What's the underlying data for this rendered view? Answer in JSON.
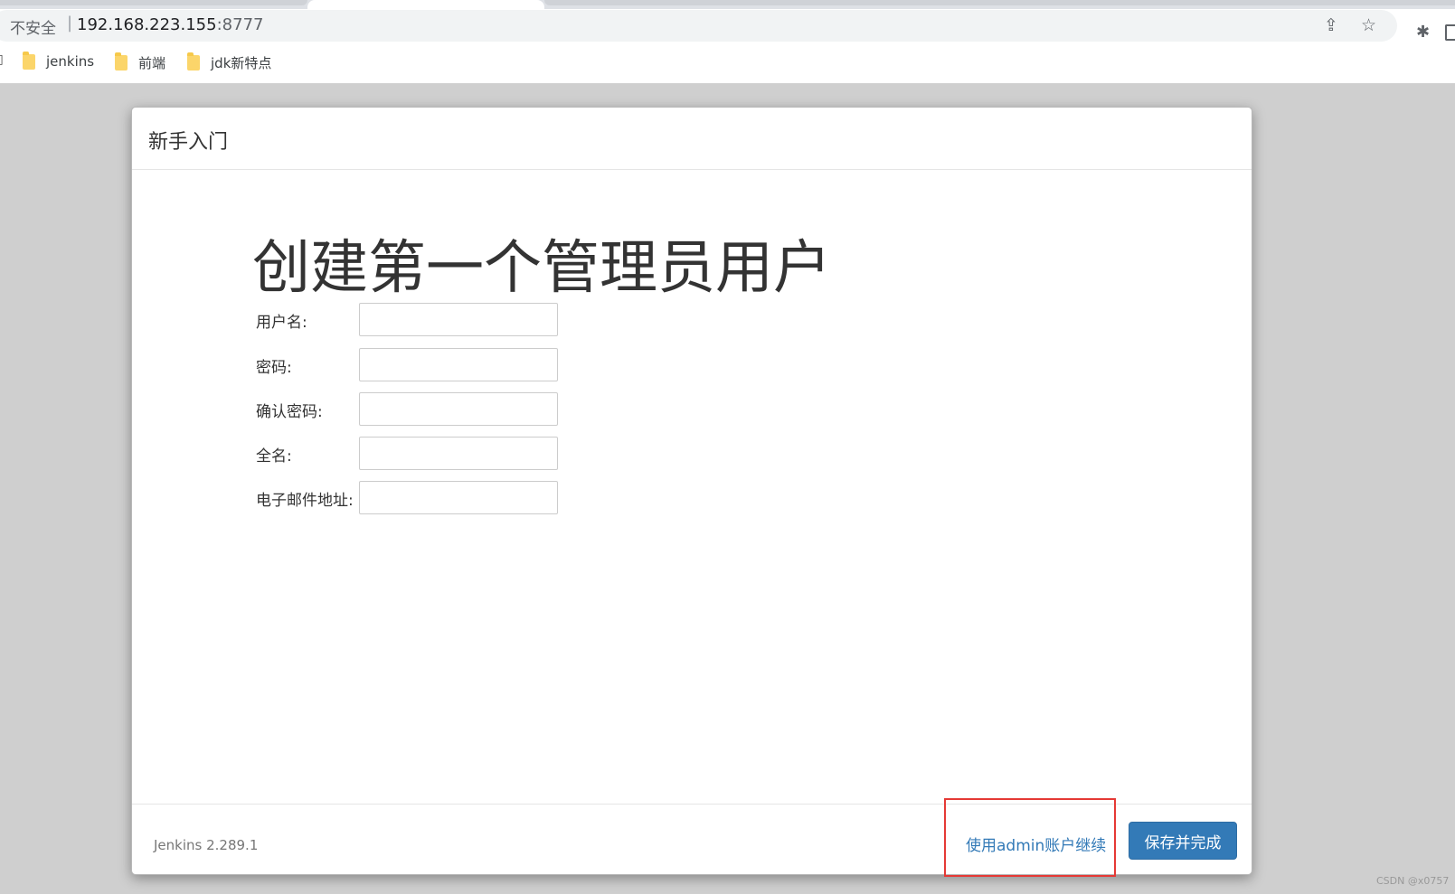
{
  "browser": {
    "security_label": "不安全",
    "separator": "|",
    "url_host": "192.168.223.155",
    "url_port": ":8777",
    "bookmarks": [
      {
        "label": "jenkins"
      },
      {
        "label": "前端"
      },
      {
        "label": "jdk新特点"
      }
    ]
  },
  "modal": {
    "title": "新手入门",
    "heading": "创建第一个管理员用户",
    "fields": [
      {
        "label": "用户名:",
        "value": ""
      },
      {
        "label": "密码:",
        "value": ""
      },
      {
        "label": "确认密码:",
        "value": ""
      },
      {
        "label": "全名:",
        "value": ""
      },
      {
        "label": "电子邮件地址:",
        "value": ""
      }
    ],
    "footer": {
      "version": "Jenkins 2.289.1",
      "admin_link": "使用admin账户继续",
      "save_label": "保存并完成"
    }
  },
  "colors": {
    "primary": "#337ab7",
    "highlight": "#e53935"
  },
  "watermark": "CSDN @x0757"
}
